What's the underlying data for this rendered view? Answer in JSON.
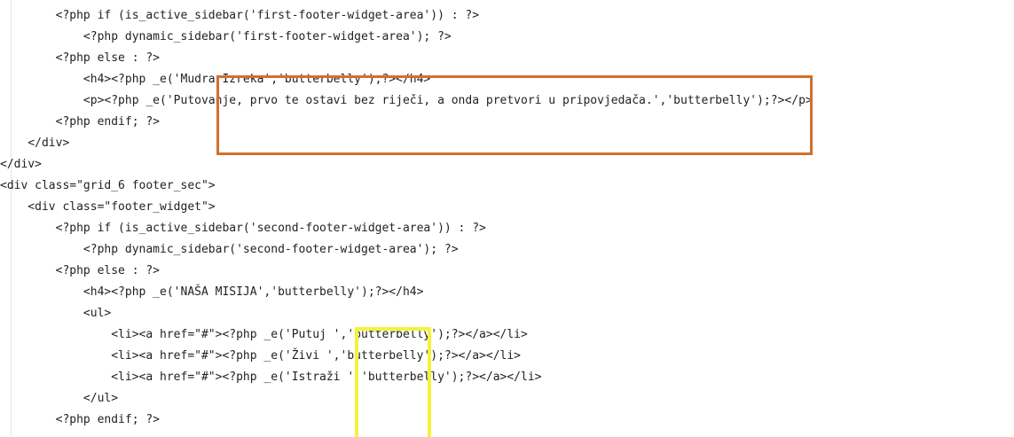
{
  "editor": {
    "lines": [
      "        <?php if (is_active_sidebar('first-footer-widget-area')) : ?>",
      "            <?php dynamic_sidebar('first-footer-widget-area'); ?>",
      "        <?php else : ?>",
      "            <h4><?php _e('Mudra Izreka','butterbelly');?></h4>",
      "            <p><?php _e('Putovanje, prvo te ostavi bez riječi, a onda pretvori u pripovjedača.','butterbelly');?></p>",
      "        <?php endif; ?>",
      "    </div>",
      "</div>",
      "<div class=\"grid_6 footer_sec\">",
      "    <div class=\"footer_widget\">",
      "        <?php if (is_active_sidebar('second-footer-widget-area')) : ?>",
      "            <?php dynamic_sidebar('second-footer-widget-area'); ?>",
      "        <?php else : ?>",
      "            <h4><?php _e('NAŠA MISIJA','butterbelly');?></h4>",
      "            <ul>",
      "                <li><a href=\"#\"><?php _e('Putuj ','butterbelly');?></a></li>",
      "                <li><a href=\"#\"><?php _e('Živi ','butterbelly');?></a></li>",
      "                <li><a href=\"#\"><?php _e('Istraži ','butterbelly');?></a></li>",
      "            </ul>",
      "        <?php endif; ?>"
    ]
  },
  "highlights": {
    "orange_color": "#d2702a",
    "yellow_color": "#f4f23a"
  }
}
